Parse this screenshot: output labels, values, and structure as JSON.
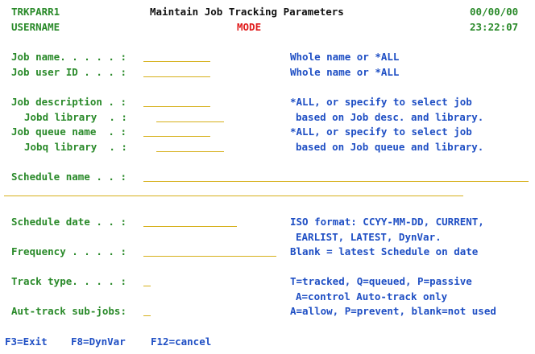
{
  "header": {
    "program": "TRKPARR1",
    "title": "Maintain Job Tracking Parameters",
    "user": "USERNAME",
    "mode": "MODE",
    "date": "00/00/00",
    "time": "23:22:07"
  },
  "form": {
    "job_name": {
      "label": "Job name. . . . . :",
      "value": "",
      "hint": "Whole name or *ALL"
    },
    "job_user": {
      "label": "Job user ID . . . :",
      "value": "",
      "hint": "Whole name or *ALL"
    },
    "job_desc": {
      "label": "Job description . :",
      "value": "",
      "hint": "*ALL, or specify to select job"
    },
    "jobd_lib": {
      "label": "Jobd library  . :",
      "value": "",
      "hint": "based on Job desc. and library."
    },
    "job_queue": {
      "label": "Job queue name  . :",
      "value": "",
      "hint": "*ALL, or specify to select job"
    },
    "jobq_lib": {
      "label": "Jobq library  . :",
      "value": "",
      "hint": "based on Job queue and library."
    },
    "schedule_name": {
      "label": "Schedule name . . :",
      "value": ""
    },
    "schedule_date": {
      "label": "Schedule date . . :",
      "value": "",
      "hint1": "ISO format: CCYY-MM-DD, CURRENT,",
      "hint2": "EARLIST, LATEST, DynVar."
    },
    "frequency": {
      "label": "Frequency . . . . :",
      "value": "",
      "hint": "Blank = latest Schedule on date"
    },
    "track_type": {
      "label": "Track type. . . . :",
      "value": "",
      "hint1": "T=tracked, Q=queued, P=passive",
      "hint2": "A=control Auto-track only"
    },
    "aut_track": {
      "label": "Aut-track sub-jobs:",
      "value": "",
      "hint": "A=allow, P=prevent, blank=not used"
    }
  },
  "function_keys": {
    "f3": "F3=Exit",
    "f8": "F8=DynVar",
    "f12": "F12=cancel"
  }
}
